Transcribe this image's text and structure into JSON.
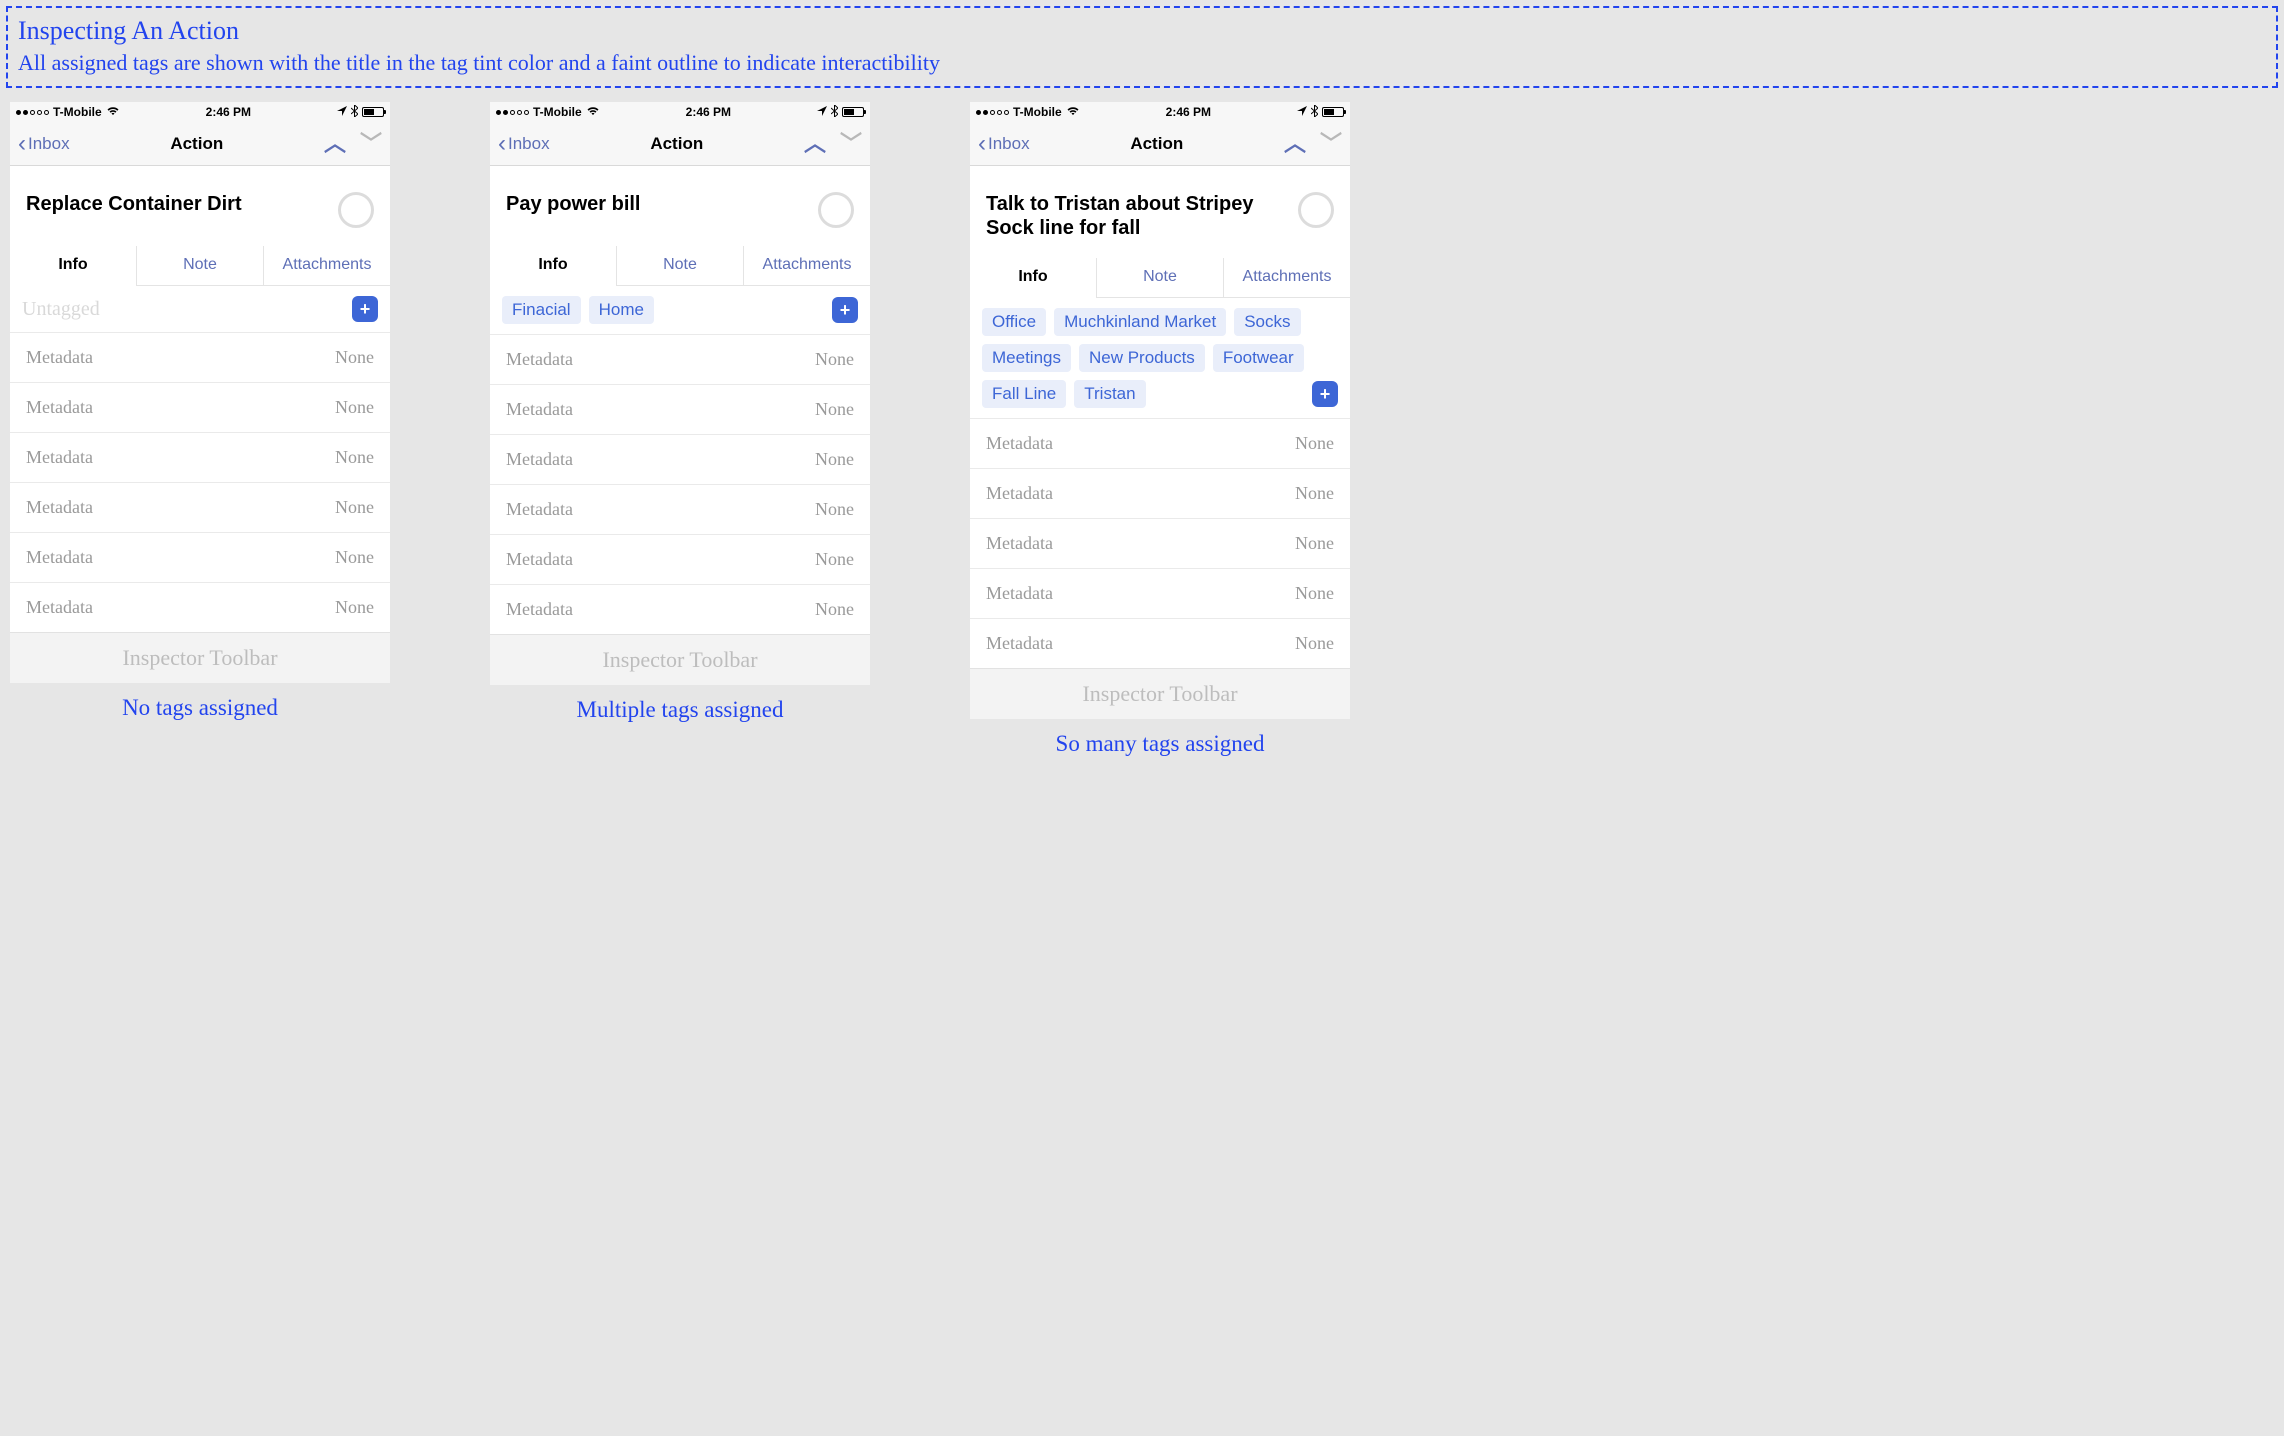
{
  "annotation": {
    "title": "Inspecting An Action",
    "subtitle": "All assigned tags are shown with the title in the tag tint color and a faint outline to indicate interactibility"
  },
  "statusbar": {
    "carrier": "T-Mobile",
    "time": "2:46 PM"
  },
  "nav": {
    "back_label": "Inbox",
    "title": "Action"
  },
  "tabs": {
    "info": "Info",
    "note": "Note",
    "attachments": "Attachments"
  },
  "untagged_label": "Untagged",
  "metadata": {
    "key": "Metadata",
    "value": "None"
  },
  "inspector_toolbar": "Inspector Toolbar",
  "screens": [
    {
      "action_title": "Replace Container Dirt",
      "tags": [],
      "meta_rows": 6,
      "caption": "No tags assigned"
    },
    {
      "action_title": "Pay power bill",
      "tags": [
        "Finacial",
        "Home"
      ],
      "meta_rows": 6,
      "caption": "Multiple tags assigned"
    },
    {
      "action_title": "Talk to Tristan about Stripey Sock line for fall",
      "tags": [
        "Office",
        "Muchkinland Market",
        "Socks",
        "Meetings",
        "New Products",
        "Footwear",
        "Fall Line",
        "Tristan"
      ],
      "meta_rows": 5,
      "caption": "So many tags assigned"
    }
  ]
}
